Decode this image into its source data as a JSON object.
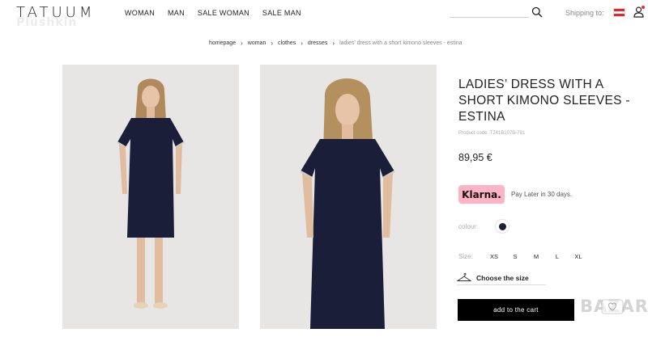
{
  "header": {
    "logo": "TATUUM",
    "watermark": "Plushkin",
    "nav": [
      "WOMAN",
      "MAN",
      "SALE WOMAN",
      "SALE MAN"
    ],
    "shipping_label": "Shipping to:",
    "flag_colors": [
      "#e3262b",
      "#ffffff",
      "#e3262b"
    ],
    "icons": [
      "search-icon",
      "user-icon"
    ]
  },
  "breadcrumb": {
    "items": [
      "homepage",
      "woman",
      "clothes",
      "dresses"
    ],
    "current": "ladies’ dress with a short kimono sleeves - estina"
  },
  "product": {
    "title": "LADIES’ DRESS WITH A SHORT KIMONO SLEEVES - ESTINA",
    "code": "Product code: T241B107B-781",
    "price": "89,95 €",
    "klarna_label": "Klarna.",
    "klarna_text": "Pay Later in 30 days.",
    "colour_label": "colour:",
    "colour_value": "#1b1e38",
    "size_label": "Size:",
    "sizes": [
      "XS",
      "S",
      "M",
      "L",
      "XL"
    ],
    "choose_size": "Choose the size",
    "cart_button": "add to the cart"
  },
  "watermark_bazar": "BAZAR",
  "colors": {
    "klarna_pink": "#ffb3c7",
    "dress_navy": "#1b1e38",
    "button_black": "#000000",
    "photo_bg": "#e7e6e4"
  }
}
